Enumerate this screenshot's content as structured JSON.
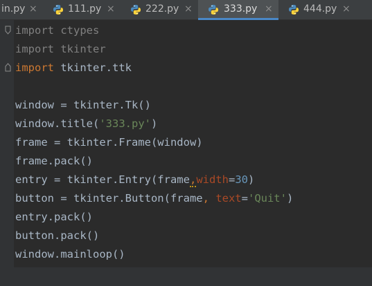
{
  "tabs": [
    {
      "label": "in.py",
      "active": false,
      "has_icon": false
    },
    {
      "label": "111.py",
      "active": false,
      "has_icon": true
    },
    {
      "label": "222.py",
      "active": false,
      "has_icon": true
    },
    {
      "label": "333.py",
      "active": true,
      "has_icon": true
    },
    {
      "label": "444.py",
      "active": false,
      "has_icon": true
    }
  ],
  "tab_close_glyph": "×",
  "colors": {
    "editor_bg": "#2b2b2b",
    "tabbar_bg": "#3c3f41",
    "active_tab_bg": "#4e5254",
    "active_tab_underline": "#4a88c7",
    "keyword": "#cc7832",
    "string": "#6a8759",
    "number": "#6897bb",
    "parameter": "#aa4926",
    "default_text": "#a9b7c6",
    "unused_import": "#808080"
  },
  "code": {
    "line1": {
      "kw": "import",
      "rest": " ctypes"
    },
    "line2": {
      "kw": "import",
      "rest": " tkinter"
    },
    "line3": {
      "kw": "import",
      "rest": " tkinter.ttk"
    },
    "line5": "window = tkinter.Tk()",
    "line6": {
      "a": "window.title(",
      "s": "'333.py'",
      "b": ")"
    },
    "line7": "frame = tkinter.Frame(window)",
    "line8": "frame.pack()",
    "line9": {
      "a": "entry = tkinter.Entry(frame",
      "comma": ",",
      "p": "width",
      "eq": "=",
      "n": "30",
      "b": ")"
    },
    "line10": {
      "a": "button = tkinter.Button(frame",
      "comma": ",",
      "sp": " ",
      "p": "text",
      "eq": "=",
      "s": "'Quit'",
      "b": ")"
    },
    "line11": "entry.pack()",
    "line12": "button.pack()",
    "line13": "window.mainloop()"
  }
}
